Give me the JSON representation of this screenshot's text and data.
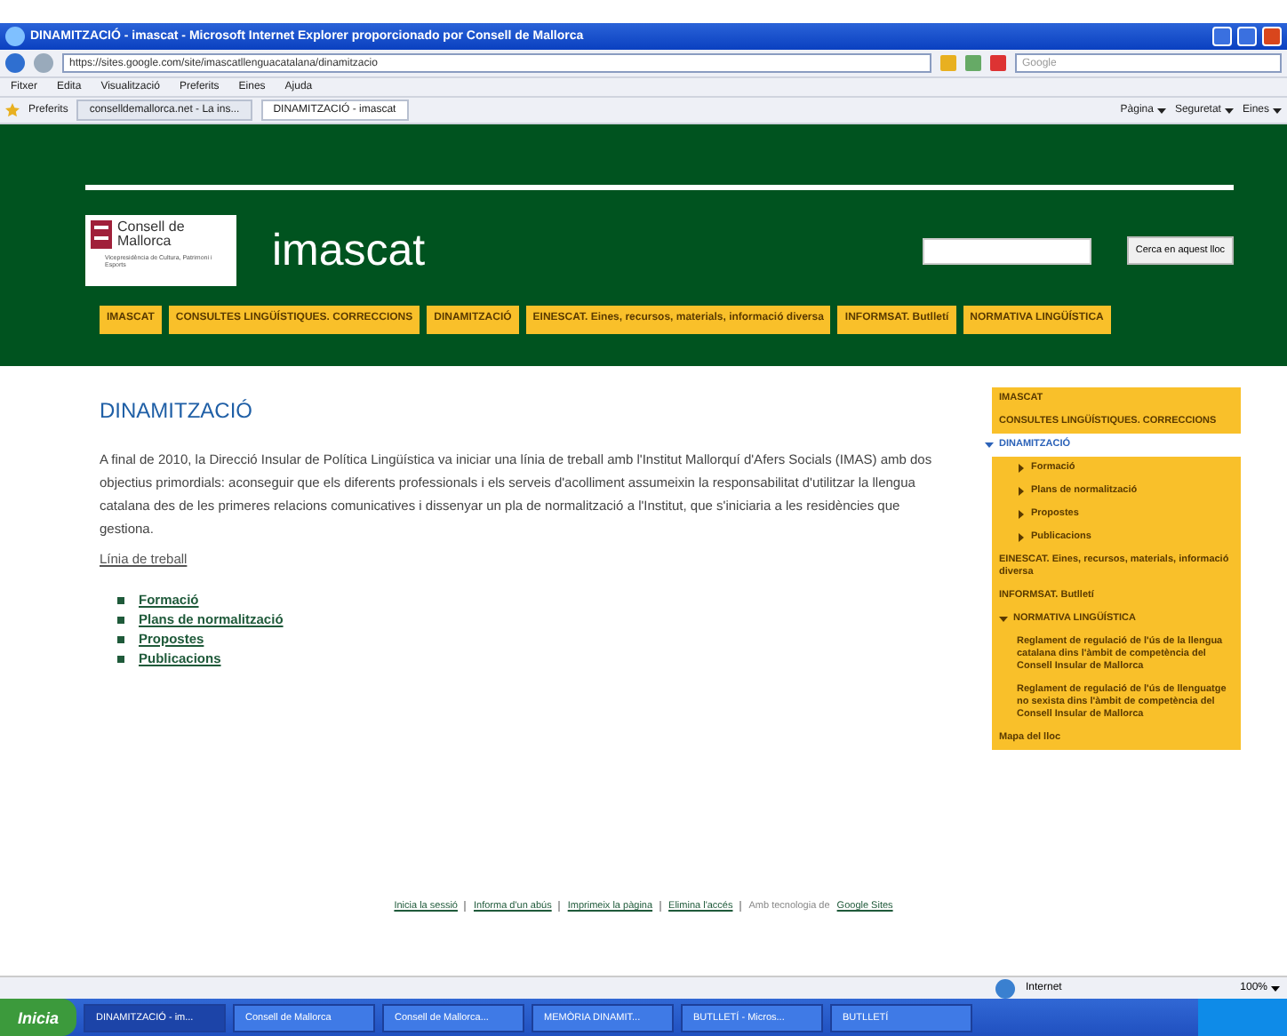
{
  "browser": {
    "title": "DINAMITZACIÓ - imascat - Microsoft Internet Explorer proporcionado por Consell de Mallorca",
    "address": "https://sites.google.com/site/imascatllenguacatalana/dinamitzacio",
    "search_placeholder": "Google",
    "menu": [
      "Fitxer",
      "Edita",
      "Visualització",
      "Preferits",
      "Eines",
      "Ajuda"
    ],
    "favorites_label": "Preferits",
    "tabs": [
      {
        "label": "conselldemallorca.net - La ins...",
        "selected": false
      },
      {
        "label": "DINAMITZACIÓ - imascat",
        "selected": true
      }
    ],
    "commands": [
      "Pàgina",
      "Seguretat",
      "Eines"
    ]
  },
  "page": {
    "logo": {
      "name_line_1": "Consell de",
      "name_line_2": "Mallorca",
      "subtitle": "Vicepresidència de Cultura, Patrimoni i Esports"
    },
    "site_title": "imascat",
    "search_button": "Cerca en aquest lloc",
    "nav": [
      "IMASCAT",
      "CONSULTES LINGÜÍSTIQUES. CORRECCIONS",
      "DINAMITZACIÓ",
      "EINESCAT. Eines, recursos, materials, informació diversa",
      "INFORMSAT. Butlletí",
      "NORMATIVA LINGÜÍSTICA"
    ],
    "heading": "DINAMITZACIÓ",
    "paragraph": "A final de 2010, la Direcció Insular de Política Lingüística va iniciar una línia de treball amb l'Institut Mallorquí d'Afers Socials (IMAS) amb dos objectius primordials: aconseguir que els diferents professionals i els serveis d'acolliment assumeixin la responsabilitat d'utilitzar la llengua catalana des de les primeres relacions comunicatives i dissenyar un pla de normalització a l'Institut, que s'iniciaria a les residències que gestiona.",
    "section_link": "Línia de treball",
    "items": [
      "Formació",
      "Plans de normalització",
      "Propostes",
      "Publicacions"
    ],
    "sidebar": [
      {
        "label": "IMASCAT",
        "selected": false
      },
      {
        "label": "CONSULTES LINGÜÍSTIQUES. CORRECCIONS",
        "selected": false
      },
      {
        "label": "DINAMITZACIÓ",
        "selected": true,
        "expanded": true,
        "children": [
          {
            "label": "Formació",
            "selected": false,
            "expanded": false
          },
          {
            "label": "Plans de normalització",
            "selected": false,
            "expanded": false
          },
          {
            "label": "Propostes",
            "selected": false,
            "expanded": false
          },
          {
            "label": "Publicacions",
            "selected": false,
            "expanded": false
          }
        ]
      },
      {
        "label": "EINESCAT. Eines, recursos, materials, informació diversa",
        "selected": false
      },
      {
        "label": "INFORMSAT. Butlletí",
        "selected": false
      },
      {
        "label": "NORMATIVA LINGÜÍSTICA",
        "selected": false,
        "expanded": true,
        "children": [
          {
            "label": "Reglament de regulació de l'ús de la llengua catalana dins l'àmbit de competència del Consell Insular de Mallorca",
            "selected": false
          },
          {
            "label": "Reglament de regulació de l'ús de llenguatge no sexista dins l'àmbit de competència del Consell Insular de Mallorca",
            "selected": false
          }
        ]
      },
      {
        "label": "Mapa del lloc",
        "selected": false
      }
    ],
    "footer": {
      "links": [
        "Inicia la sessió",
        "Informa d'un abús",
        "Imprimeix la pàgina",
        "Elimina l'accés"
      ],
      "powered_by": "Amb tecnologia de",
      "powered_link": "Google Sites"
    }
  },
  "status_bar": {
    "zone": "Internet",
    "zoom": "100%"
  },
  "taskbar": {
    "start": "Inicia",
    "items": [
      {
        "label": "DINAMITZACIÓ - im...",
        "selected": true
      },
      {
        "label": "Consell de Mallorca",
        "selected": false
      },
      {
        "label": "Consell de Mallorca...",
        "selected": false
      },
      {
        "label": "MEMÒRIA DINAMIT...",
        "selected": false
      },
      {
        "label": "BUTLLETÍ - Micros...",
        "selected": false
      },
      {
        "label": "BUTLLETÍ",
        "selected": false
      }
    ]
  }
}
